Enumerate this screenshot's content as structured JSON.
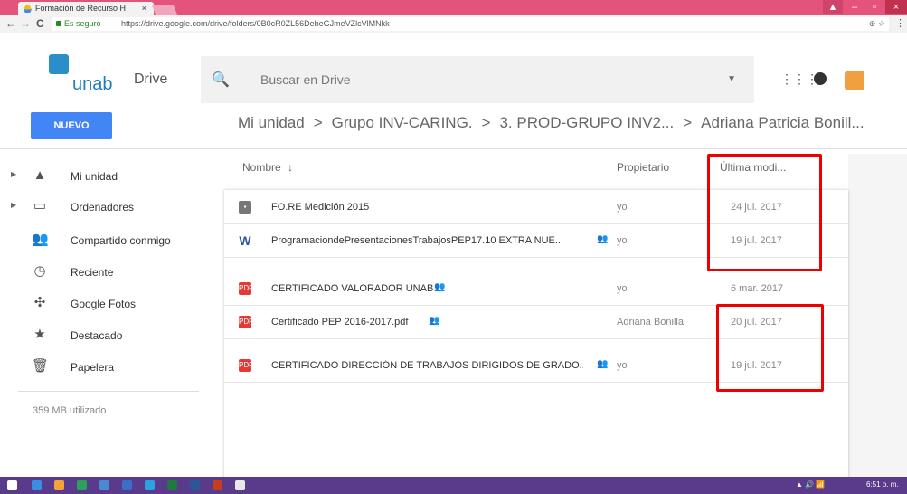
{
  "browser": {
    "tab_title": "Formación de Recurso H",
    "tab_close": "×",
    "secure_label": "Es seguro",
    "url": "https://drive.google.com/drive/folders/0B0cR0ZL56DebeGJmeVZlcVlMNkk",
    "zoom_icon": "⊕",
    "star_icon": "☆",
    "menu_icon": "⋮",
    "back_icon": "←",
    "forward_icon": "→",
    "reload_icon": "C",
    "win_min": "–",
    "win_max": "▫",
    "win_close": "×",
    "user_icon": "▲"
  },
  "header": {
    "brand": "unab",
    "product": "Drive",
    "search_placeholder": "Buscar en Drive",
    "search_icon": "🔍",
    "dropdown_icon": "▼",
    "grid_icon": "⋮⋮⋮",
    "colors": {
      "accent": "#4285f4",
      "brand": "#1c7fbd",
      "highlight": "#e00000"
    }
  },
  "new_button": "NUEVO",
  "breadcrumb": [
    "Mi unidad",
    "Grupo INV-CARING.",
    "3. PROD-GRUPO INV2...",
    "Adriana Patricia Bonill..."
  ],
  "breadcrumb_sep": ">",
  "sidebar": {
    "items": [
      {
        "label": "Mi unidad",
        "icon": "drive-icon",
        "glyph": "▲",
        "expandable": true
      },
      {
        "label": "Ordenadores",
        "icon": "computer-icon",
        "glyph": "▭",
        "expandable": true
      },
      {
        "label": "Compartido conmigo",
        "icon": "shared-icon",
        "glyph": "👥",
        "expandable": false
      },
      {
        "label": "Reciente",
        "icon": "clock-icon",
        "glyph": "◷",
        "expandable": false
      },
      {
        "label": "Google Fotos",
        "icon": "photos-icon",
        "glyph": "✣",
        "expandable": false
      },
      {
        "label": "Destacado",
        "icon": "star-icon",
        "glyph": "★",
        "expandable": false
      },
      {
        "label": "Papelera",
        "icon": "trash-icon",
        "glyph": "🗑",
        "expandable": false
      }
    ],
    "expand_glyph": "▶",
    "usage": "359 MB utilizado"
  },
  "columns": {
    "name": "Nombre",
    "sort_icon": "↓",
    "owner": "Propietario",
    "modified": "Última modi..."
  },
  "files": [
    {
      "name": "FO.RE Medición 2015",
      "type": "folder",
      "badge": "▪",
      "shared": false,
      "owner": "yo",
      "date": "24 jul. 2017"
    },
    {
      "name": "ProgramaciondePresentacionesTrabajosPEP17.10 EXTRA NUE...",
      "type": "word",
      "badge": "W",
      "shared": true,
      "owner": "yo",
      "date": "19 jul. 2017"
    },
    {
      "name": "CERTIFICADO VALORADOR UNAB",
      "type": "pdf",
      "badge": "PDF",
      "shared": true,
      "owner": "yo",
      "date": "6 mar. 2017"
    },
    {
      "name": "Certificado PEP 2016-2017.pdf",
      "type": "pdf",
      "badge": "PDF",
      "shared": true,
      "owner": "Adriana Bonilla",
      "date": "20 jul. 2017"
    },
    {
      "name": "CERTIFICADO DIRECCIÓN DE TRABAJOS DIRIGIDOS DE GRADO...",
      "type": "pdf",
      "badge": "PDF",
      "shared": true,
      "owner": "yo",
      "date": "19 jul. 2017"
    }
  ],
  "shared_glyph": "👥",
  "taskbar": {
    "clock": "6:51 p. m.",
    "tray": "▲ 🔊 📶"
  }
}
